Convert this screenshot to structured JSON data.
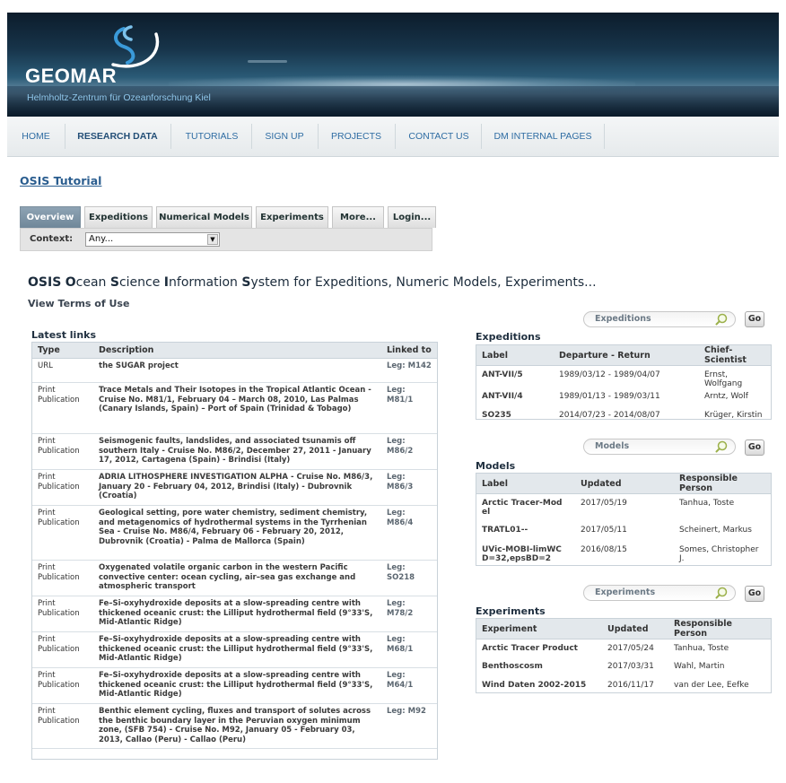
{
  "banner": {
    "logo_text": "GEOMAR",
    "subtitle": "Helmholtz-Zentrum für Ozeanforschung Kiel"
  },
  "nav": [
    {
      "label": "HOME"
    },
    {
      "label": "RESEARCH DATA",
      "active": true
    },
    {
      "label": "TUTORIALS"
    },
    {
      "label": "SIGN UP"
    },
    {
      "label": "PROJECTS"
    },
    {
      "label": "CONTACT US"
    },
    {
      "label": "DM INTERNAL PAGES"
    }
  ],
  "tutorial_link": "OSIS Tutorial",
  "tabs": [
    {
      "label": "Overview",
      "active": true
    },
    {
      "label": "Expeditions"
    },
    {
      "label": "Numerical Models"
    },
    {
      "label": "Experiments"
    },
    {
      "label": "More..."
    },
    {
      "label": "Login..."
    }
  ],
  "context": {
    "label": "Context:",
    "value": "Any..."
  },
  "headline": {
    "parts": [
      {
        "b": "OSIS",
        "t": " "
      },
      {
        "b": "O",
        "t": "cean "
      },
      {
        "b": "S",
        "t": "cience "
      },
      {
        "b": "I",
        "t": "nformation "
      },
      {
        "b": "S",
        "t": "ystem for Expeditions, Numeric Models, Experiments..."
      }
    ]
  },
  "terms": "View Terms of Use",
  "latest_links": {
    "title": "Latest links",
    "columns": [
      "Type",
      "Description",
      "Linked to"
    ],
    "rows": [
      {
        "type": "URL",
        "desc": "the SUGAR project",
        "leg": "Leg: M142"
      },
      {
        "type": "Print Publication",
        "desc": "Trace Metals and Their Isotopes in the Tropical Atlantic Ocean - Cruise No. M81/1, February 04 – March 08, 2010, Las Palmas (Canary Islands, Spain) – Port of Spain (Trinidad & Tobago)",
        "leg": "Leg: M81/1"
      },
      {
        "type": "Print Publication",
        "desc": "Seismogenic faults, landslides, and associated tsunamis off southern Italy - Cruise No. M86/2, December 27, 2011 - January 17, 2012, Cartagena (Spain) - Brindisi (Italy)",
        "leg": "Leg: M86/2"
      },
      {
        "type": "Print Publication",
        "desc": "ADRIA LITHOSPHERE INVESTIGATION ALPHA - Cruise No. M86/3, January 20 - February 04, 2012, Brindisi (Italy) - Dubrovnik (Croatia)",
        "leg": "Leg: M86/3"
      },
      {
        "type": "Print Publication",
        "desc": "Geological setting, pore water chemistry, sediment chemistry, and metagenomics of hydrothermal systems in the Tyrrhenian Sea - Cruise No. M86/4, February 06 - February 20, 2012, Dubrovnik (Croatia) - Palma de Mallorca (Spain)",
        "leg": "Leg: M86/4"
      },
      {
        "type": "Print Publication",
        "desc": "Oxygenated volatile organic carbon in the western Pacific convective center: ocean cycling, air–sea gas exchange and atmospheric transport",
        "leg": "Leg: SO218"
      },
      {
        "type": "Print Publication",
        "desc": "Fe–Si-oxyhydroxide deposits at a slow-spreading centre with thickened oceanic crust: the Lilliput hydrothermal field (9°33'S, Mid-Atlantic Ridge)",
        "leg": "Leg: M78/2"
      },
      {
        "type": "Print Publication",
        "desc": "Fe–Si-oxyhydroxide deposits at a slow-spreading centre with thickened oceanic crust: the Lilliput hydrothermal field (9°33'S, Mid-Atlantic Ridge)",
        "leg": "Leg: M68/1"
      },
      {
        "type": "Print Publication",
        "desc": "Fe–Si-oxyhydroxide deposits at a slow-spreading centre with thickened oceanic crust: the Lilliput hydrothermal field (9°33'S, Mid-Atlantic Ridge)",
        "leg": "Leg: M64/1"
      },
      {
        "type": "Print Publication",
        "desc": "Benthic element cycling, fluxes and transport of solutes across the benthic boundary layer in the Peruvian oxygen minimum zone, (SFB 754) - Cruise No. M92, January 05 - February 03, 2013, Callao (Peru) - Callao (Peru)",
        "leg": "Leg: M92"
      }
    ]
  },
  "expeditions": {
    "search_placeholder": "Expeditions",
    "go": "Go",
    "title": "Expeditions",
    "columns": [
      "Label",
      "Departure - Return",
      "Chief-Scientist"
    ],
    "rows": [
      [
        "ANT-VII/5",
        "1989/03/12 - 1989/04/07",
        "Ernst, Wolfgang"
      ],
      [
        "ANT-VII/4",
        "1989/01/13 - 1989/03/11",
        "Arntz, Wolf"
      ],
      [
        "SO235",
        "2014/07/23 - 2014/08/07",
        "Krüger, Kirstin"
      ]
    ]
  },
  "models": {
    "search_placeholder": "Models",
    "go": "Go",
    "title": "Models",
    "columns": [
      "Label",
      "Updated",
      "Responsible Person"
    ],
    "rows": [
      [
        "Arctic Tracer-Mod el",
        "2017/05/19",
        "Tanhua, Toste"
      ],
      [
        "TRATL01--",
        "2017/05/11",
        "Scheinert, Markus"
      ],
      [
        "UVic-MOBI-limWC D=32,epsBD=2",
        "2016/08/15",
        "Somes, Christopher J."
      ]
    ]
  },
  "experiments": {
    "search_placeholder": "Experiments",
    "go": "Go",
    "title": "Experiments",
    "columns": [
      "Experiment",
      "Updated",
      "Responsible Person"
    ],
    "rows": [
      [
        "Arctic Tracer Product",
        "2017/05/24",
        "Tanhua, Toste"
      ],
      [
        "Benthoscosm",
        "2017/03/31",
        "Wahl, Martin"
      ],
      [
        "Wind Daten 2002-2015",
        "2016/11/17",
        "van der Lee, Eefke"
      ]
    ]
  }
}
